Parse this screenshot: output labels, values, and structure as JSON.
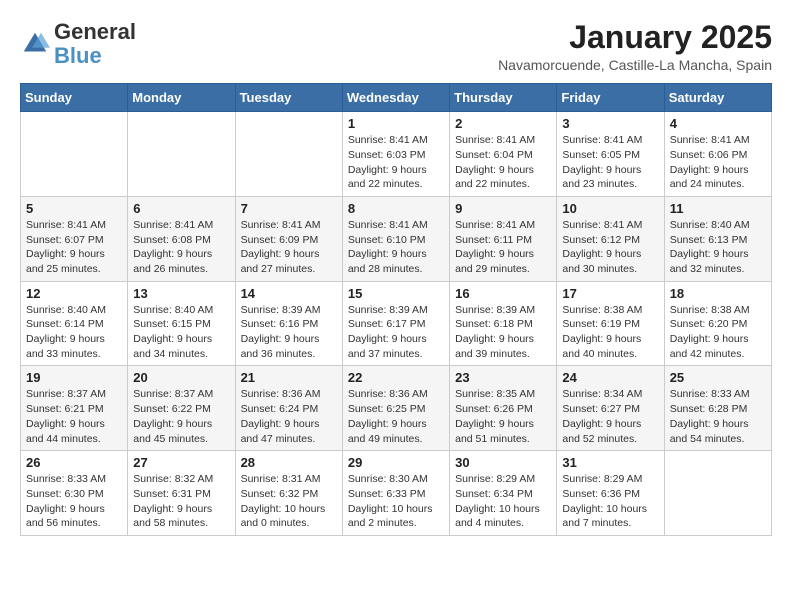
{
  "logo": {
    "line1": "General",
    "line2": "Blue"
  },
  "title": "January 2025",
  "subtitle": "Navamorcuende, Castille-La Mancha, Spain",
  "days_of_week": [
    "Sunday",
    "Monday",
    "Tuesday",
    "Wednesday",
    "Thursday",
    "Friday",
    "Saturday"
  ],
  "weeks": [
    [
      {
        "day": "",
        "info": ""
      },
      {
        "day": "",
        "info": ""
      },
      {
        "day": "",
        "info": ""
      },
      {
        "day": "1",
        "info": "Sunrise: 8:41 AM\nSunset: 6:03 PM\nDaylight: 9 hours\nand 22 minutes."
      },
      {
        "day": "2",
        "info": "Sunrise: 8:41 AM\nSunset: 6:04 PM\nDaylight: 9 hours\nand 22 minutes."
      },
      {
        "day": "3",
        "info": "Sunrise: 8:41 AM\nSunset: 6:05 PM\nDaylight: 9 hours\nand 23 minutes."
      },
      {
        "day": "4",
        "info": "Sunrise: 8:41 AM\nSunset: 6:06 PM\nDaylight: 9 hours\nand 24 minutes."
      }
    ],
    [
      {
        "day": "5",
        "info": "Sunrise: 8:41 AM\nSunset: 6:07 PM\nDaylight: 9 hours\nand 25 minutes."
      },
      {
        "day": "6",
        "info": "Sunrise: 8:41 AM\nSunset: 6:08 PM\nDaylight: 9 hours\nand 26 minutes."
      },
      {
        "day": "7",
        "info": "Sunrise: 8:41 AM\nSunset: 6:09 PM\nDaylight: 9 hours\nand 27 minutes."
      },
      {
        "day": "8",
        "info": "Sunrise: 8:41 AM\nSunset: 6:10 PM\nDaylight: 9 hours\nand 28 minutes."
      },
      {
        "day": "9",
        "info": "Sunrise: 8:41 AM\nSunset: 6:11 PM\nDaylight: 9 hours\nand 29 minutes."
      },
      {
        "day": "10",
        "info": "Sunrise: 8:41 AM\nSunset: 6:12 PM\nDaylight: 9 hours\nand 30 minutes."
      },
      {
        "day": "11",
        "info": "Sunrise: 8:40 AM\nSunset: 6:13 PM\nDaylight: 9 hours\nand 32 minutes."
      }
    ],
    [
      {
        "day": "12",
        "info": "Sunrise: 8:40 AM\nSunset: 6:14 PM\nDaylight: 9 hours\nand 33 minutes."
      },
      {
        "day": "13",
        "info": "Sunrise: 8:40 AM\nSunset: 6:15 PM\nDaylight: 9 hours\nand 34 minutes."
      },
      {
        "day": "14",
        "info": "Sunrise: 8:39 AM\nSunset: 6:16 PM\nDaylight: 9 hours\nand 36 minutes."
      },
      {
        "day": "15",
        "info": "Sunrise: 8:39 AM\nSunset: 6:17 PM\nDaylight: 9 hours\nand 37 minutes."
      },
      {
        "day": "16",
        "info": "Sunrise: 8:39 AM\nSunset: 6:18 PM\nDaylight: 9 hours\nand 39 minutes."
      },
      {
        "day": "17",
        "info": "Sunrise: 8:38 AM\nSunset: 6:19 PM\nDaylight: 9 hours\nand 40 minutes."
      },
      {
        "day": "18",
        "info": "Sunrise: 8:38 AM\nSunset: 6:20 PM\nDaylight: 9 hours\nand 42 minutes."
      }
    ],
    [
      {
        "day": "19",
        "info": "Sunrise: 8:37 AM\nSunset: 6:21 PM\nDaylight: 9 hours\nand 44 minutes."
      },
      {
        "day": "20",
        "info": "Sunrise: 8:37 AM\nSunset: 6:22 PM\nDaylight: 9 hours\nand 45 minutes."
      },
      {
        "day": "21",
        "info": "Sunrise: 8:36 AM\nSunset: 6:24 PM\nDaylight: 9 hours\nand 47 minutes."
      },
      {
        "day": "22",
        "info": "Sunrise: 8:36 AM\nSunset: 6:25 PM\nDaylight: 9 hours\nand 49 minutes."
      },
      {
        "day": "23",
        "info": "Sunrise: 8:35 AM\nSunset: 6:26 PM\nDaylight: 9 hours\nand 51 minutes."
      },
      {
        "day": "24",
        "info": "Sunrise: 8:34 AM\nSunset: 6:27 PM\nDaylight: 9 hours\nand 52 minutes."
      },
      {
        "day": "25",
        "info": "Sunrise: 8:33 AM\nSunset: 6:28 PM\nDaylight: 9 hours\nand 54 minutes."
      }
    ],
    [
      {
        "day": "26",
        "info": "Sunrise: 8:33 AM\nSunset: 6:30 PM\nDaylight: 9 hours\nand 56 minutes."
      },
      {
        "day": "27",
        "info": "Sunrise: 8:32 AM\nSunset: 6:31 PM\nDaylight: 9 hours\nand 58 minutes."
      },
      {
        "day": "28",
        "info": "Sunrise: 8:31 AM\nSunset: 6:32 PM\nDaylight: 10 hours\nand 0 minutes."
      },
      {
        "day": "29",
        "info": "Sunrise: 8:30 AM\nSunset: 6:33 PM\nDaylight: 10 hours\nand 2 minutes."
      },
      {
        "day": "30",
        "info": "Sunrise: 8:29 AM\nSunset: 6:34 PM\nDaylight: 10 hours\nand 4 minutes."
      },
      {
        "day": "31",
        "info": "Sunrise: 8:29 AM\nSunset: 6:36 PM\nDaylight: 10 hours\nand 7 minutes."
      },
      {
        "day": "",
        "info": ""
      }
    ]
  ]
}
